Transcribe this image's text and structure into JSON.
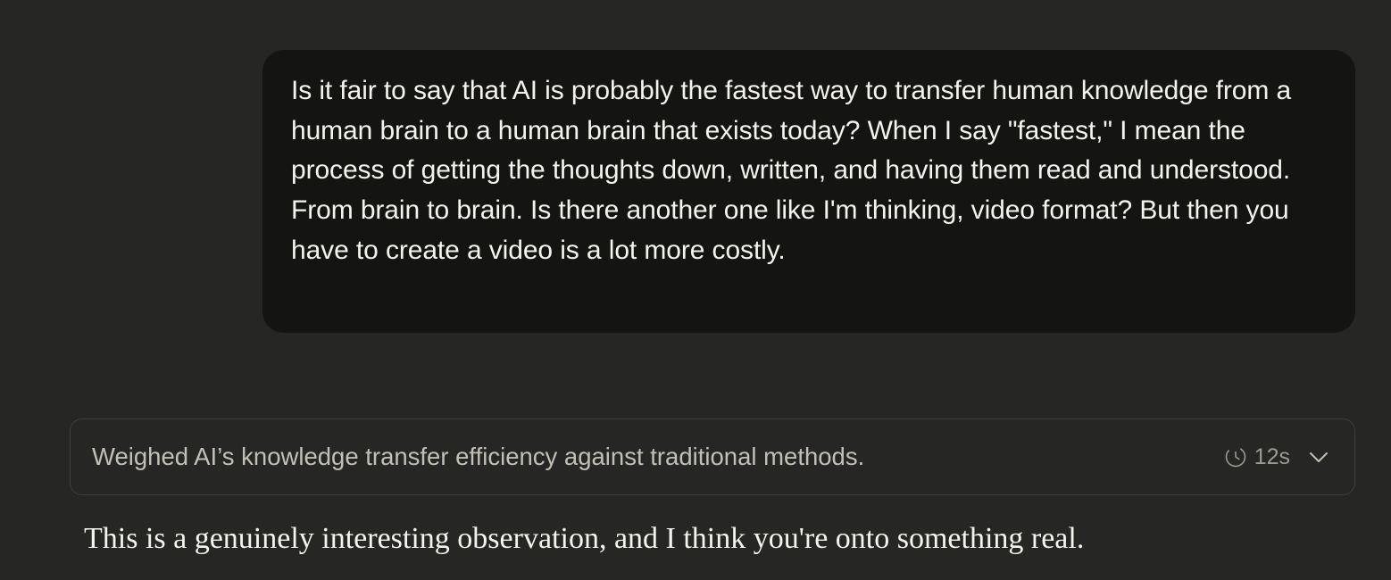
{
  "conversation": {
    "user_message": {
      "text": "Is it fair to say that AI is probably the fastest way to transfer human knowledge from a human brain to a human brain that exists today? When I say \"fastest,\" I mean the process of getting the thoughts down, written, and having them read and understood. From brain to brain. Is there another one like I'm thinking, video format? But then you have to create a video is a lot more costly."
    },
    "thinking": {
      "summary": "Weighed AI’s knowledge transfer efficiency against traditional methods.",
      "duration": "12s",
      "icons": [
        "clock-icon",
        "chevron-down-icon"
      ]
    },
    "assistant_message": {
      "text": "This is a genuinely interesting observation, and I think you're onto something real."
    }
  },
  "colors": {
    "background": "#262624",
    "user_bubble": "#141413",
    "text_primary": "#f4f3ee",
    "text_secondary": "#c2c0b6",
    "text_muted": "#9c9a92",
    "border": "#3e3e3a"
  }
}
